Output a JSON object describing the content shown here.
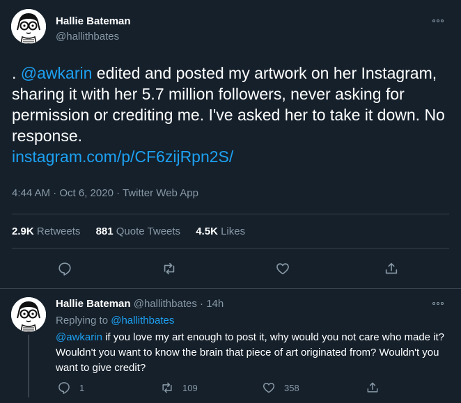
{
  "main_tweet": {
    "display_name": "Hallie Bateman",
    "handle": "@hallithbates",
    "text_lead": ". ",
    "mention": "@awkarin",
    "text_body": " edited and posted my artwork on her Instagram, sharing it with her 5.7 million followers, never asking for permission or crediting me. I've asked her to take it down. No response.",
    "link": "instagram.com/p/CF6zijRpn2S/",
    "meta": "4:44 AM · Oct 6, 2020 · Twitter Web App",
    "stats": {
      "retweets_count": "2.9K",
      "retweets_label": "Retweets",
      "quotes_count": "881",
      "quotes_label": "Quote Tweets",
      "likes_count": "4.5K",
      "likes_label": "Likes"
    }
  },
  "reply_tweet": {
    "display_name": "Hallie Bateman",
    "handle": "@hallithbates",
    "separator": "·",
    "time": "14h",
    "replying_label": "Replying to",
    "replying_to": "@hallithbates",
    "mention": "@awkarin",
    "text_body": " if you love my art enough to post it, why would you not care who made it? Wouldn't you want to know the brain that piece of art originated from? Wouldn't you want to give credit?",
    "reply_count": "1",
    "retweet_count": "109",
    "like_count": "358"
  },
  "colors": {
    "background": "#15202b",
    "text": "#ffffff",
    "muted": "#8899a6",
    "accent": "#1da1f2",
    "divider": "#38444d"
  },
  "icons": [
    "more-icon",
    "reply-icon",
    "retweet-icon",
    "like-icon",
    "share-icon"
  ]
}
